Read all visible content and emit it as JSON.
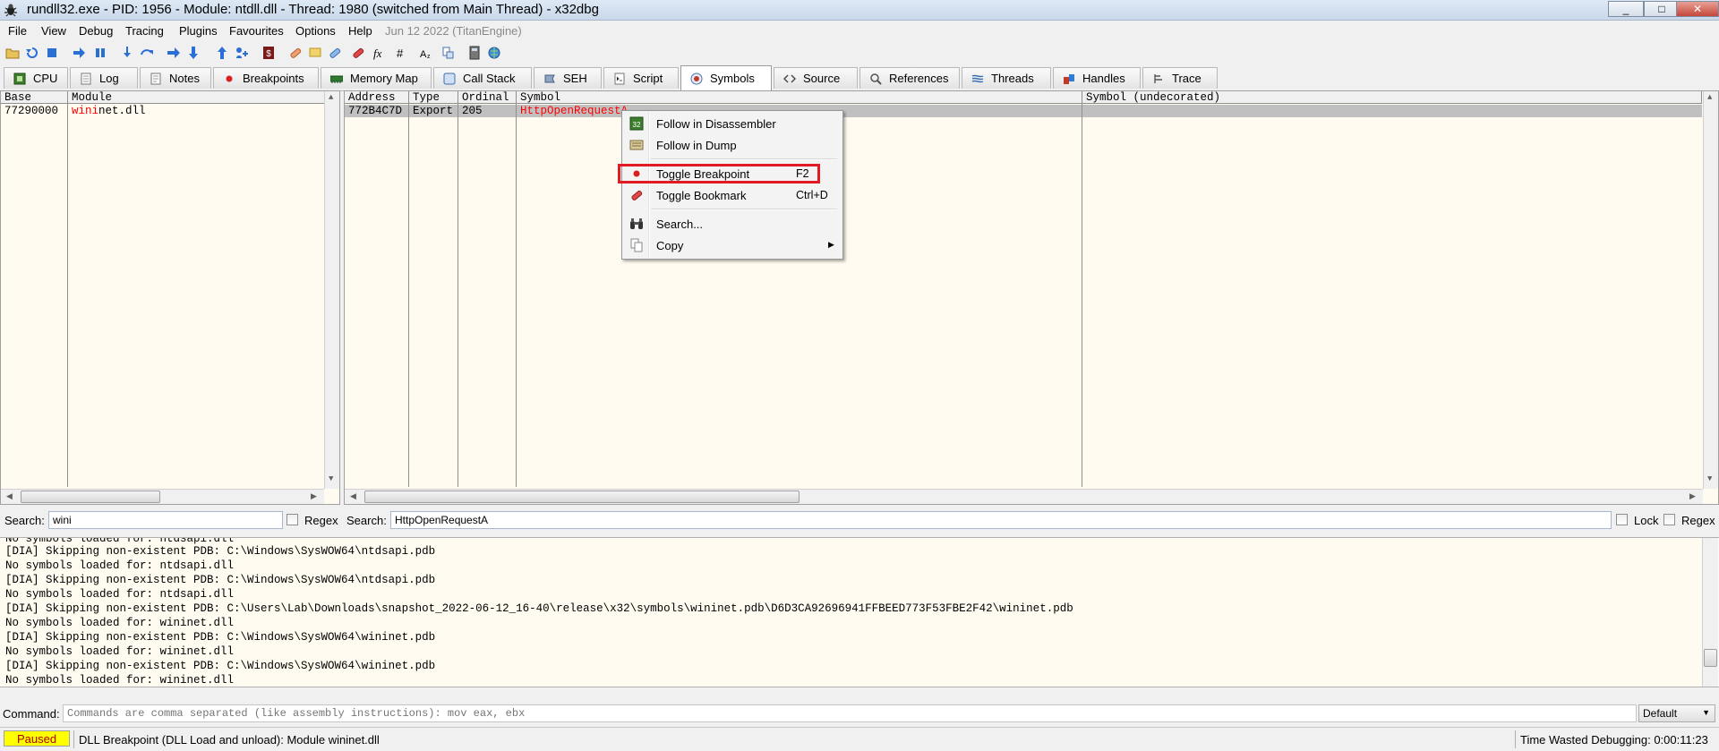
{
  "window": {
    "title": "rundll32.exe - PID: 1956 - Module: ntdll.dll - Thread: 1980 (switched from Main Thread) - x32dbg",
    "icon": "bug-icon",
    "minimize": "_",
    "maximize": "□",
    "close": "✕"
  },
  "menu": {
    "items": [
      "File",
      "View",
      "Debug",
      "Tracing",
      "Plugins",
      "Favourites",
      "Options",
      "Help"
    ],
    "build_info": "Jun 12 2022 (TitanEngine)"
  },
  "toolbar": {
    "icons": [
      "open-icon",
      "restart-icon",
      "stop-icon",
      "run-icon",
      "pause-icon",
      "step-into-icon",
      "step-over-icon",
      "trace-into-icon",
      "trace-over-icon",
      "execute-till-return-icon",
      "run-to-user-code-icon",
      "script-icon",
      "patch-icon",
      "comment-icon",
      "label-icon",
      "bookmark-icon",
      "function-icon",
      "hash-icon",
      "font-icon",
      "module-icon",
      "calculator-icon",
      "globe-icon"
    ]
  },
  "tabs": [
    {
      "label": "CPU",
      "icon": "cpu-icon"
    },
    {
      "label": "Log",
      "icon": "log-icon"
    },
    {
      "label": "Notes",
      "icon": "notes-icon"
    },
    {
      "label": "Breakpoints",
      "icon": "breakpoint-dot-icon"
    },
    {
      "label": "Memory Map",
      "icon": "memory-icon"
    },
    {
      "label": "Call Stack",
      "icon": "call-stack-icon"
    },
    {
      "label": "SEH",
      "icon": "seh-icon"
    },
    {
      "label": "Script",
      "icon": "script-icon"
    },
    {
      "label": "Symbols",
      "icon": "symbols-icon",
      "active": true
    },
    {
      "label": "Source",
      "icon": "source-code-icon"
    },
    {
      "label": "References",
      "icon": "references-icon"
    },
    {
      "label": "Threads",
      "icon": "threads-icon"
    },
    {
      "label": "Handles",
      "icon": "handles-icon"
    },
    {
      "label": "Trace",
      "icon": "trace-icon"
    }
  ],
  "modules_pane": {
    "columns": [
      "Base",
      "Module"
    ],
    "rows": [
      {
        "base": "77290000",
        "module_match": "wini",
        "module_rest": "net.dll"
      }
    ]
  },
  "symbols_pane": {
    "columns": [
      "Address",
      "Type",
      "Ordinal",
      "Symbol",
      "Symbol (undecorated)"
    ],
    "rows": [
      {
        "address": "772B4C7D",
        "type": "Export",
        "ordinal": "205",
        "symbol": "HttpOpenRequestA",
        "undecorated": ""
      }
    ]
  },
  "search_left": {
    "label": "Search:",
    "value": "wini",
    "regex_label": "Regex"
  },
  "search_right": {
    "label": "Search:",
    "value": "HttpOpenRequestA",
    "lock_label": "Lock",
    "regex_label": "Regex"
  },
  "log": {
    "lines": [
      "No symbols loaded for: ntdsapi.dll",
      "[DIA] Skipping non-existent PDB: C:\\Windows\\SysWOW64\\ntdsapi.pdb",
      "No symbols loaded for: ntdsapi.dll",
      "[DIA] Skipping non-existent PDB: C:\\Windows\\SysWOW64\\ntdsapi.pdb",
      "No symbols loaded for: ntdsapi.dll",
      "[DIA] Skipping non-existent PDB: C:\\Users\\Lab\\Downloads\\snapshot_2022-06-12_16-40\\release\\x32\\symbols\\wininet.pdb\\D6D3CA92696941FFBEED773F53FBE2F42\\wininet.pdb",
      "No symbols loaded for: wininet.dll",
      "[DIA] Skipping non-existent PDB: C:\\Windows\\SysWOW64\\wininet.pdb",
      "No symbols loaded for: wininet.dll",
      "[DIA] Skipping non-existent PDB: C:\\Windows\\SysWOW64\\wininet.pdb",
      "No symbols loaded for: wininet.dll"
    ]
  },
  "command": {
    "label": "Command:",
    "placeholder": "Commands are comma separated (like assembly instructions): mov eax, ebx",
    "mode": "Default"
  },
  "status": {
    "state": "Paused",
    "message": "DLL Breakpoint (DLL Load and unload): Module wininet.dll",
    "time_wasted": "Time Wasted Debugging: 0:00:11:23"
  },
  "context_menu": {
    "items": [
      {
        "label": "Follow in Disassembler",
        "shortcut": "",
        "icon": "cpu-icon"
      },
      {
        "label": "Follow in Dump",
        "shortcut": "",
        "icon": "dump-icon"
      },
      {
        "label": "Toggle Breakpoint",
        "shortcut": "F2",
        "icon": "breakpoint-dot-icon"
      },
      {
        "label": "Toggle Bookmark",
        "shortcut": "Ctrl+D",
        "icon": "bookmark-icon"
      },
      {
        "label": "Search...",
        "shortcut": "",
        "icon": "binoculars-icon"
      },
      {
        "label": "Copy",
        "shortcut": "",
        "icon": "copy-icon"
      }
    ]
  },
  "colors": {
    "pane_background": "#fffbf0",
    "match_highlight": "#ff0000",
    "annotation_box": "#e01b24",
    "paused_background": "#ffff00"
  }
}
